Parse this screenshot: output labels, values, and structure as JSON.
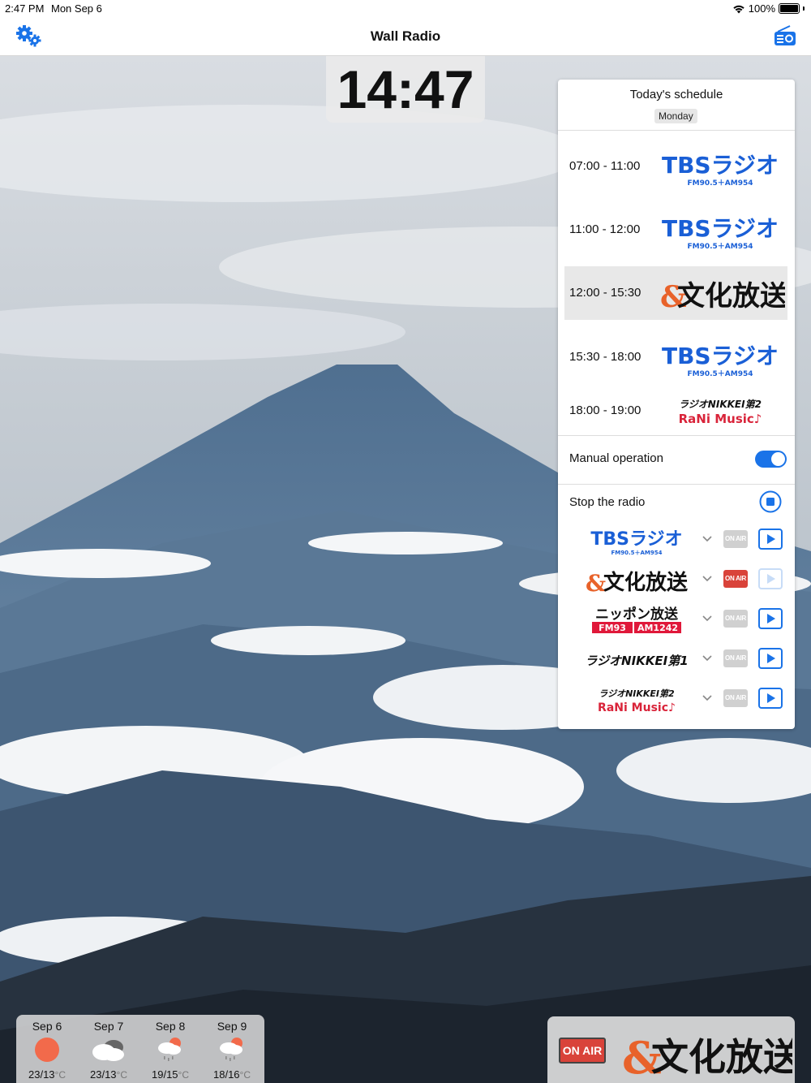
{
  "status_bar": {
    "time": "2:47 PM",
    "date": "Mon Sep 6",
    "battery": "100%"
  },
  "nav": {
    "title": "Wall Radio",
    "left_icon": "settings-gears-icon",
    "right_icon": "radio-icon"
  },
  "clock": {
    "time": "14:47"
  },
  "schedule": {
    "title": "Today's schedule",
    "day": "Monday",
    "slots": [
      {
        "time": "07:00 - 11:00",
        "station": "TBSラジオ",
        "sub": "FM90.5＋AM954",
        "active": false
      },
      {
        "time": "11:00 - 12:00",
        "station": "TBSラジオ",
        "sub": "FM90.5＋AM954",
        "active": false
      },
      {
        "time": "12:00 - 15:30",
        "station": "文化放送",
        "active": true
      },
      {
        "time": "15:30 - 18:00",
        "station": "TBSラジオ",
        "sub": "FM90.5＋AM954",
        "active": false
      },
      {
        "time": "18:00 - 19:00",
        "station": "ラジオNIKKEI第2",
        "sub": "RaNi Music♪",
        "active": false
      }
    ]
  },
  "manual": {
    "label": "Manual operation",
    "enabled": true
  },
  "stop": {
    "label": "Stop the radio"
  },
  "stations": [
    {
      "name": "TBSラジオ",
      "sub": "FM90.5＋AM954",
      "onair": "ON AIR",
      "on_air": false
    },
    {
      "name": "文化放送",
      "onair": "ON AIR",
      "on_air": true
    },
    {
      "name": "ニッポン放送",
      "sub1": "FM93",
      "sub2": "AM1242",
      "onair": "ON AIR",
      "on_air": false
    },
    {
      "name": "ラジオNIKKEI第1",
      "onair": "ON AIR",
      "on_air": false
    },
    {
      "name": "ラジオNIKKEI第2",
      "sub": "RaNi Music♪",
      "onair": "ON AIR",
      "on_air": false
    }
  ],
  "weather": [
    {
      "date": "Sep 6",
      "icon": "sun-icon",
      "high": "23",
      "low": "13",
      "unit": "°C"
    },
    {
      "date": "Sep 7",
      "icon": "cloudy-icon",
      "high": "23",
      "low": "13",
      "unit": "°C"
    },
    {
      "date": "Sep 8",
      "icon": "rain-sun-icon",
      "high": "19",
      "low": "15",
      "unit": "°C"
    },
    {
      "date": "Sep 9",
      "icon": "rain-sun-icon",
      "high": "18",
      "low": "16",
      "unit": "°C"
    }
  ],
  "now_playing": {
    "badge": "ON AIR",
    "station": "文化放送"
  },
  "colors": {
    "accent": "#1a73e8",
    "onair_active": "#d9433a",
    "onair_inactive": "#d0d0d0",
    "tbs_blue": "#1a5fd6"
  }
}
